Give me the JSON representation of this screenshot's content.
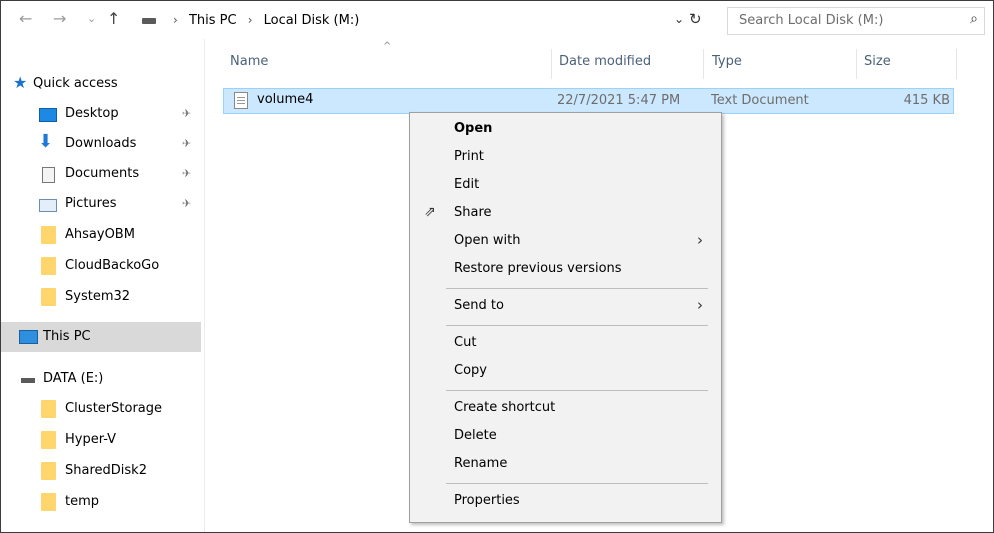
{
  "nav": {
    "back": "←",
    "forward": "→",
    "recent": "⌄",
    "up": "↑"
  },
  "address": {
    "crumbs": [
      "This PC",
      "Local Disk (M:)"
    ],
    "separator": "›",
    "dropdown": "⌄",
    "refresh": "↻"
  },
  "search": {
    "placeholder": "Search Local Disk (M:)",
    "icon": "⌕"
  },
  "sidebar": {
    "quick_access": "Quick access",
    "pinned": [
      {
        "label": "Desktop",
        "pin": "✈"
      },
      {
        "label": "Downloads",
        "pin": "✈"
      },
      {
        "label": "Documents",
        "pin": "✈"
      },
      {
        "label": "Pictures",
        "pin": "✈"
      }
    ],
    "folders": [
      "AhsayOBM",
      "CloudBackoGo",
      "System32"
    ],
    "this_pc": "This PC",
    "drive": "DATA (E:)",
    "drive_folders": [
      "ClusterStorage",
      "Hyper-V",
      "SharedDisk2",
      "temp"
    ]
  },
  "columns": {
    "name": "Name",
    "date": "Date modified",
    "type": "Type",
    "size": "Size",
    "sort_glyph": "^"
  },
  "file": {
    "name": "volume4",
    "date": "22/7/2021 5:47 PM",
    "type": "Text Document",
    "size": "415 KB"
  },
  "context_menu": {
    "open": "Open",
    "print": "Print",
    "edit": "Edit",
    "share": "Share",
    "open_with": "Open with",
    "restore": "Restore previous versions",
    "send_to": "Send to",
    "cut": "Cut",
    "copy": "Copy",
    "create_shortcut": "Create shortcut",
    "delete": "Delete",
    "rename": "Rename",
    "properties": "Properties",
    "submenu_arrow": "›",
    "share_icon": "⇗"
  }
}
